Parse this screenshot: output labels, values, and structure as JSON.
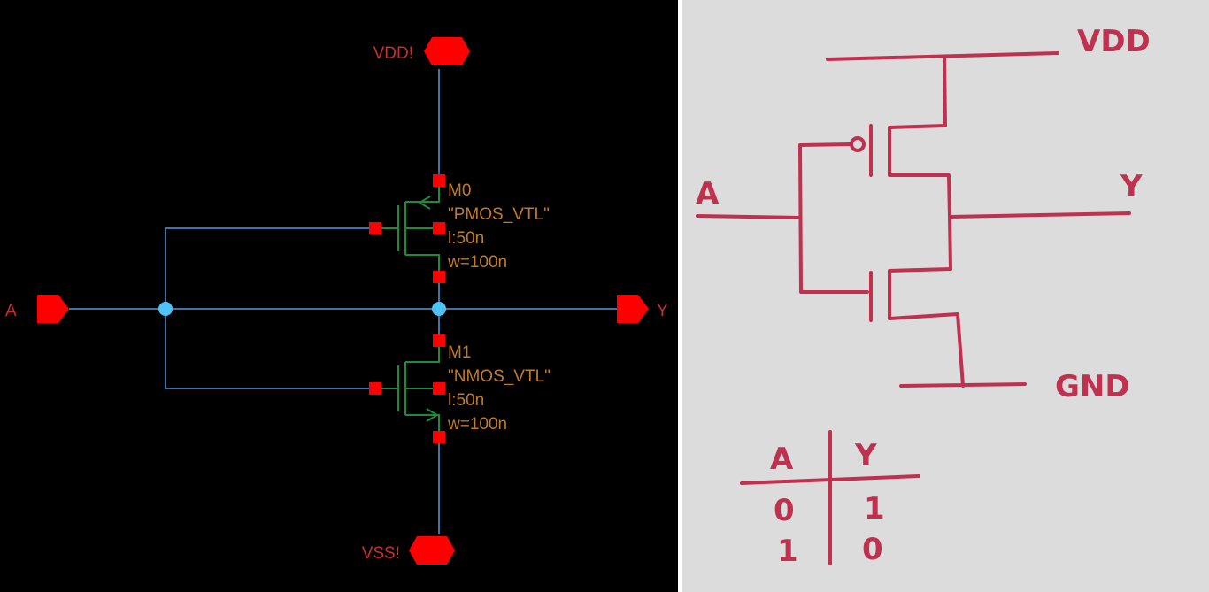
{
  "colors": {
    "schematic_background": "#000000",
    "wire": "#3c74a8",
    "pin_fill": "#ff0000",
    "pin_text": "#c8302a",
    "device": "#1f8a3a",
    "device_text": "#c07a2a",
    "junction": "#4fc3f7",
    "paper": "#dcdcdc",
    "ink": "#c0304f"
  },
  "schematic": {
    "pins": {
      "vdd": "VDD!",
      "vss": "VSS!",
      "input": "A",
      "output": "Y"
    },
    "pmos": {
      "instance": "M0",
      "model": "\"PMOS_VTL\"",
      "length": "l:50n",
      "width": "w=100n"
    },
    "nmos": {
      "instance": "M1",
      "model": "\"NMOS_VTL\"",
      "length": "l:50n",
      "width": "w=100n"
    }
  },
  "sketch": {
    "vdd": "VDD",
    "gnd": "GND",
    "input": "A",
    "output": "Y",
    "truth_table": {
      "headers": [
        "A",
        "Y"
      ],
      "rows": [
        [
          "0",
          "1"
        ],
        [
          "1",
          "0"
        ]
      ]
    }
  }
}
